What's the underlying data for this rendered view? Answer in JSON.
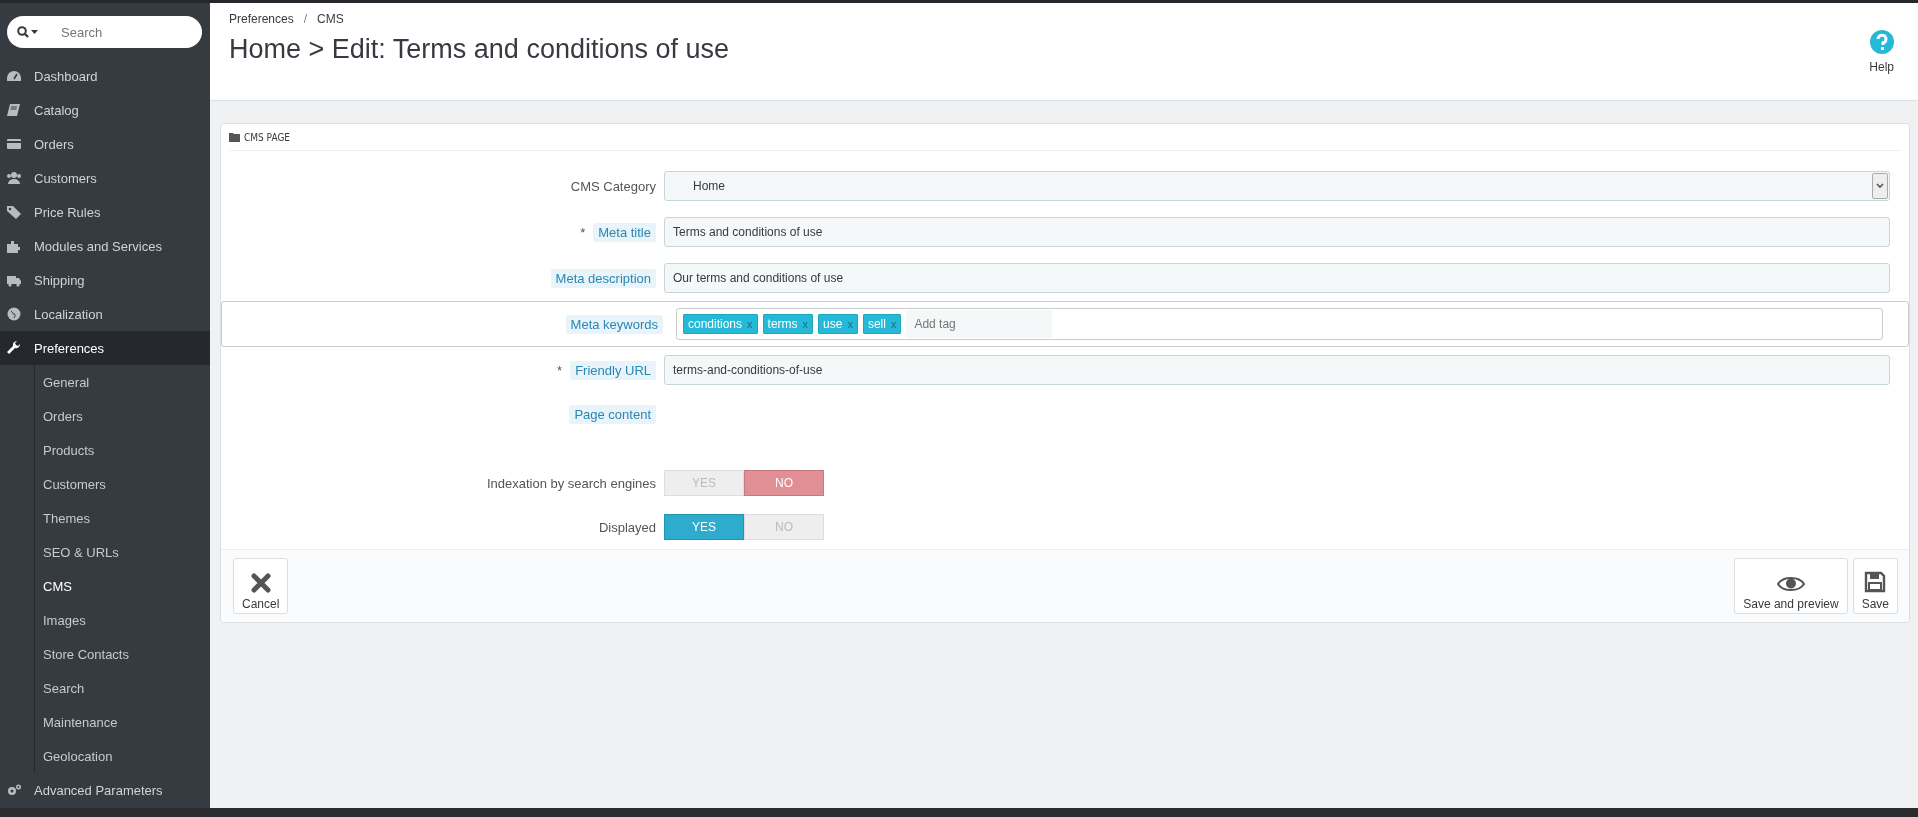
{
  "sidebar": {
    "search": {
      "placeholder": "Search"
    },
    "items": [
      {
        "label": "Dashboard",
        "selected": false
      },
      {
        "label": "Catalog",
        "selected": false
      },
      {
        "label": "Orders",
        "selected": false
      },
      {
        "label": "Customers",
        "selected": false
      },
      {
        "label": "Price Rules",
        "selected": false
      },
      {
        "label": "Modules and Services",
        "selected": false
      },
      {
        "label": "Shipping",
        "selected": false
      },
      {
        "label": "Localization",
        "selected": false
      },
      {
        "label": "Preferences",
        "selected": true,
        "children": [
          {
            "label": "General",
            "selected": false
          },
          {
            "label": "Orders",
            "selected": false
          },
          {
            "label": "Products",
            "selected": false
          },
          {
            "label": "Customers",
            "selected": false
          },
          {
            "label": "Themes",
            "selected": false
          },
          {
            "label": "SEO & URLs",
            "selected": false
          },
          {
            "label": "CMS",
            "selected": true
          },
          {
            "label": "Images",
            "selected": false
          },
          {
            "label": "Store Contacts",
            "selected": false
          },
          {
            "label": "Search",
            "selected": false
          },
          {
            "label": "Maintenance",
            "selected": false
          },
          {
            "label": "Geolocation",
            "selected": false
          }
        ]
      },
      {
        "label": "Advanced Parameters",
        "selected": false
      }
    ]
  },
  "breadcrumb": {
    "items": [
      "Preferences",
      "CMS"
    ],
    "separator": "/"
  },
  "title": "Home > Edit: Terms and conditions of use",
  "help": "Help",
  "panel": {
    "title": "CMS PAGE",
    "fields": [
      {
        "kind": "select",
        "label": "CMS Category",
        "hint": false,
        "value": "Home"
      },
      {
        "kind": "text",
        "label": "Meta title",
        "required_mark": "*",
        "hint": true,
        "value": "Terms and conditions of use"
      },
      {
        "kind": "text",
        "label": "Meta description",
        "hint": true,
        "value": "Our terms and conditions of use"
      },
      {
        "kind": "tags",
        "label": "Meta keywords",
        "hint": true,
        "tags": [
          {
            "label": "conditions",
            "remove": "x"
          },
          {
            "label": "terms",
            "remove": "x"
          },
          {
            "label": "use",
            "remove": "x"
          },
          {
            "label": "sell",
            "remove": "x"
          }
        ],
        "placeholder": "Add tag"
      },
      {
        "kind": "text",
        "label": "Friendly URL",
        "required_mark": "*",
        "hint": true,
        "value": "terms-and-conditions-of-use"
      },
      {
        "kind": "empty",
        "label": "Page content",
        "hint": true
      },
      {
        "kind": "switch",
        "label": "Indexation by search engines",
        "hint": false,
        "options": [
          {
            "label": "YES",
            "selected": false
          },
          {
            "label": "NO",
            "selected": true
          }
        ]
      },
      {
        "kind": "switch",
        "label": "Displayed",
        "hint": false,
        "options": [
          {
            "label": "YES",
            "selected": true
          },
          {
            "label": "NO",
            "selected": false
          }
        ]
      }
    ],
    "footer": {
      "left": [
        {
          "label": "Cancel",
          "kind": "cancel"
        }
      ],
      "right": [
        {
          "label": "Save and preview",
          "kind": "preview"
        },
        {
          "label": "Save",
          "kind": "save"
        }
      ]
    }
  }
}
